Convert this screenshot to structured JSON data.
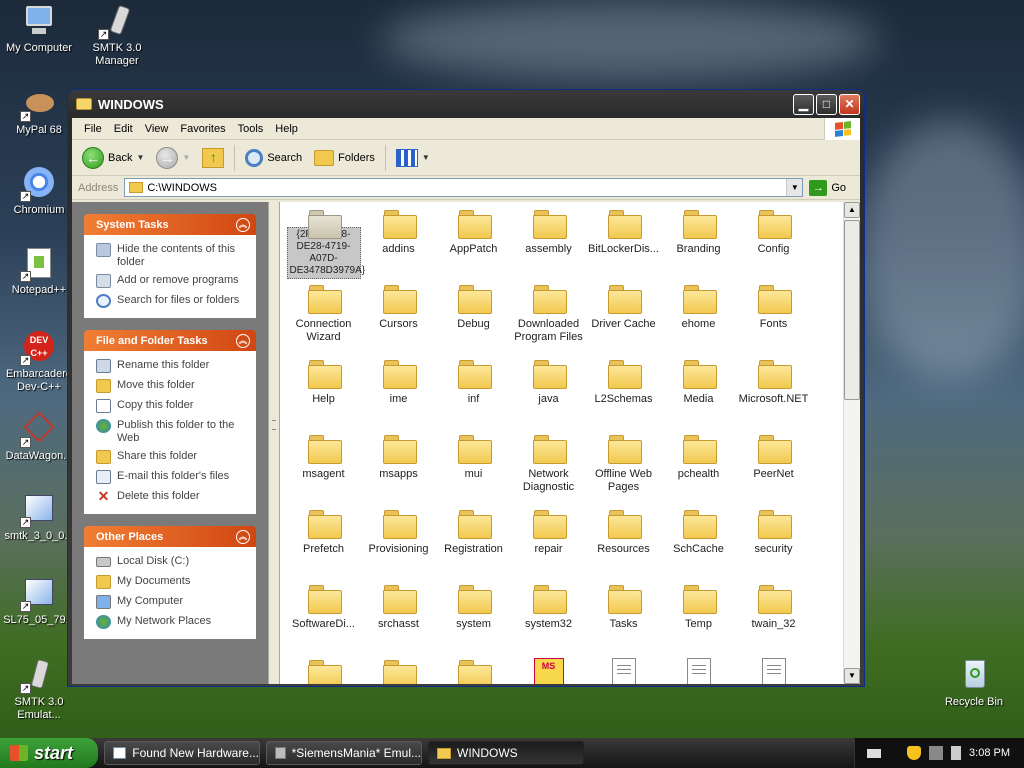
{
  "desktop": {
    "icons": [
      {
        "label": "My Computer"
      },
      {
        "label": "SMTK 3.0 Manager"
      },
      {
        "label": "MyPal 68"
      },
      {
        "label": "Chromium"
      },
      {
        "label": "Notepad++"
      },
      {
        "label": "Embarcadero Dev-C++"
      },
      {
        "label": "DataWagon..."
      },
      {
        "label": "smtk_3_0_0..."
      },
      {
        "label": "SL75_05_79..."
      },
      {
        "label": "SMTK 3.0 Emulat..."
      },
      {
        "label": "Recycle Bin"
      }
    ]
  },
  "window": {
    "title": "WINDOWS",
    "menu": [
      "File",
      "Edit",
      "View",
      "Favorites",
      "Tools",
      "Help"
    ],
    "toolbar": {
      "back": "Back",
      "search": "Search",
      "folders": "Folders"
    },
    "address": {
      "label": "Address",
      "value": "C:\\WINDOWS",
      "go": "Go"
    }
  },
  "tasks": {
    "system": {
      "title": "System Tasks",
      "items": [
        "Hide the contents of this folder",
        "Add or remove programs",
        "Search for files or folders"
      ]
    },
    "file_folder": {
      "title": "File and Folder Tasks",
      "items": [
        "Rename this folder",
        "Move this folder",
        "Copy this folder",
        "Publish this folder to the Web",
        "Share this folder",
        "E-mail this folder's files",
        "Delete this folder"
      ]
    },
    "other": {
      "title": "Other Places",
      "items": [
        "Local Disk (C:)",
        "My Documents",
        "My Computer",
        "My Network Places"
      ]
    }
  },
  "files": [
    {
      "name": "{2F7FC208-DE28-4719-A07D-DE3478D3979A}",
      "selected": true
    },
    {
      "name": "addins"
    },
    {
      "name": "AppPatch"
    },
    {
      "name": "assembly"
    },
    {
      "name": "BitLockerDis..."
    },
    {
      "name": "Branding"
    },
    {
      "name": "Config"
    },
    {
      "name": "Connection Wizard"
    },
    {
      "name": "Cursors"
    },
    {
      "name": "Debug"
    },
    {
      "name": "Downloaded Program Files"
    },
    {
      "name": "Driver Cache"
    },
    {
      "name": "ehome"
    },
    {
      "name": "Fonts"
    },
    {
      "name": "Help"
    },
    {
      "name": "ime"
    },
    {
      "name": "inf"
    },
    {
      "name": "java"
    },
    {
      "name": "L2Schemas"
    },
    {
      "name": "Media"
    },
    {
      "name": "Microsoft.NET"
    },
    {
      "name": "msagent"
    },
    {
      "name": "msapps"
    },
    {
      "name": "mui"
    },
    {
      "name": "Network Diagnostic"
    },
    {
      "name": "Offline Web Pages"
    },
    {
      "name": "pchealth"
    },
    {
      "name": "PeerNet"
    },
    {
      "name": "Prefetch"
    },
    {
      "name": "Provisioning"
    },
    {
      "name": "Registration"
    },
    {
      "name": "repair"
    },
    {
      "name": "Resources"
    },
    {
      "name": "SchCache"
    },
    {
      "name": "security"
    },
    {
      "name": "SoftwareDi..."
    },
    {
      "name": "srchasst"
    },
    {
      "name": "system"
    },
    {
      "name": "system32"
    },
    {
      "name": "Tasks"
    },
    {
      "name": "Temp"
    },
    {
      "name": "twain_32"
    }
  ],
  "taskbar": {
    "start": "start",
    "tasks": [
      "Found New Hardware...",
      "*SiemensMania* Emul...",
      "WINDOWS"
    ],
    "clock": "3:08 PM"
  }
}
